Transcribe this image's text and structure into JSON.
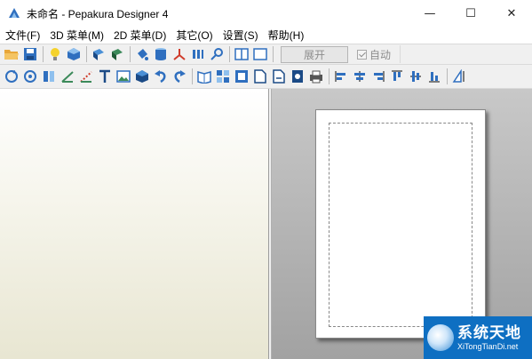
{
  "window": {
    "title": "未命名 - Pepakura Designer 4",
    "minimize": "—",
    "maximize": "☐",
    "close": "✕"
  },
  "menu": [
    {
      "label": "文件(F)"
    },
    {
      "label": "3D 菜单(M)"
    },
    {
      "label": "2D 菜单(D)"
    },
    {
      "label": "其它(O)"
    },
    {
      "label": "设置(S)"
    },
    {
      "label": "帮助(H)"
    }
  ],
  "toolbar1": {
    "icons": [
      "open-folder-icon",
      "save-icon",
      "lightbulb-icon",
      "texture-cube-icon",
      "select-face-icon",
      "select-part-icon",
      "paint-bucket-icon",
      "cylinder-icon",
      "axis-icon",
      "flip-icon",
      "link-icon",
      "layout-split-icon",
      "layout-single-icon"
    ],
    "unfold_label": "展开",
    "auto_label": "自动",
    "auto_checked": true
  },
  "toolbar2": {
    "icons": [
      "rotate-icon",
      "orbit-icon",
      "join-icon",
      "edge-icon",
      "fold-line-icon",
      "text-icon",
      "image-icon",
      "box-icon",
      "undo-icon",
      "redo-icon",
      "book-icon",
      "grid-icon",
      "fill-icon",
      "page-add-icon",
      "page-next-icon",
      "page-settings-icon",
      "print-icon",
      "align-left-icon",
      "align-center-icon",
      "align-right-icon",
      "align-top-icon",
      "align-middle-icon",
      "align-bottom-icon",
      "measure-icon"
    ]
  },
  "watermark": {
    "chinese": "系统天地",
    "url": "XiTongTianDi.net"
  },
  "colors": {
    "toolbar_bg": "#f0f0f0",
    "canvas_right": "#a8a8a8",
    "watermark_bg": "#0e6fc2",
    "folder_yellow": "#e8a73a",
    "icon_blue": "#2f6fbf"
  }
}
